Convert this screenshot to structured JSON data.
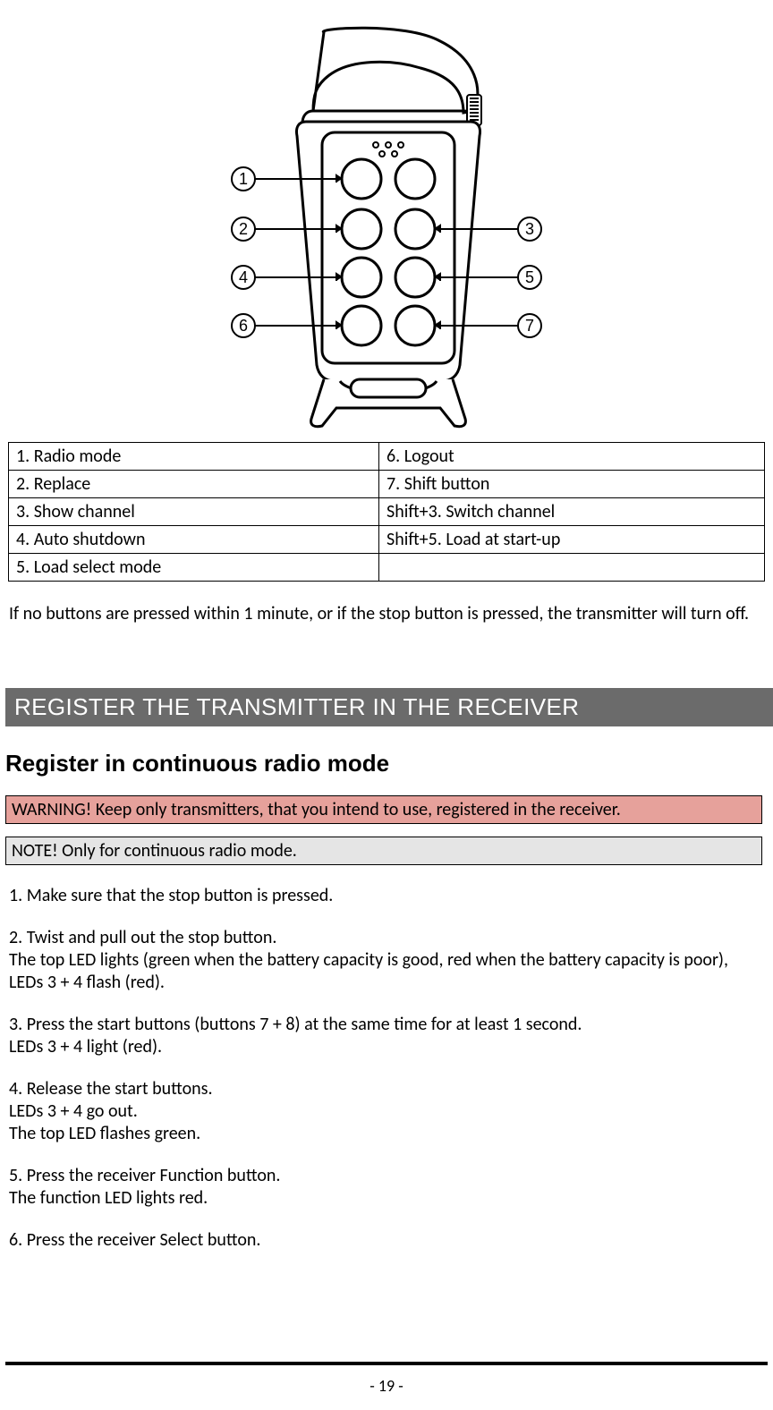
{
  "diagram": {
    "callouts": [
      "1",
      "2",
      "3",
      "4",
      "5",
      "6",
      "7"
    ]
  },
  "buttonsTable": {
    "rows": [
      {
        "left": "1. Radio mode",
        "right": "6. Logout"
      },
      {
        "left": "2. Replace",
        "right": "7. Shift button"
      },
      {
        "left": "3. Show channel",
        "right": "Shift+3. Switch channel"
      },
      {
        "left": "4. Auto shutdown",
        "right": "Shift+5. Load at start-up"
      },
      {
        "left": "5. Load select mode",
        "right": ""
      }
    ]
  },
  "paragraphAfterTable": "If no buttons are pressed within 1 minute, or if the stop button is pressed, the transmitter will turn off.",
  "sectionTitle": "REGISTER THE TRANSMITTER IN THE RECEIVER",
  "subheading": "Register in continuous radio mode",
  "warningText": "WARNING! Keep only transmitters, that you intend to use, registered in the receiver.",
  "noteText": "NOTE! Only for continuous radio mode.",
  "steps": [
    "1. Make sure that the stop button is pressed.",
    "2. Twist and pull out the stop button.\nThe top LED lights (green when the battery capacity is good, red when the battery capacity is poor), LEDs 3 + 4 flash (red).",
    "3. Press the start buttons (buttons 7 + 8) at the same time for at least 1 second.\nLEDs 3 + 4 light (red).",
    "4. Release the start buttons.\nLEDs 3 + 4 go out.\nThe top LED flashes green.",
    "5. Press the receiver Function button.\nThe function LED lights red.",
    "6. Press the receiver Select button."
  ],
  "pageNumber": "- 19 -"
}
